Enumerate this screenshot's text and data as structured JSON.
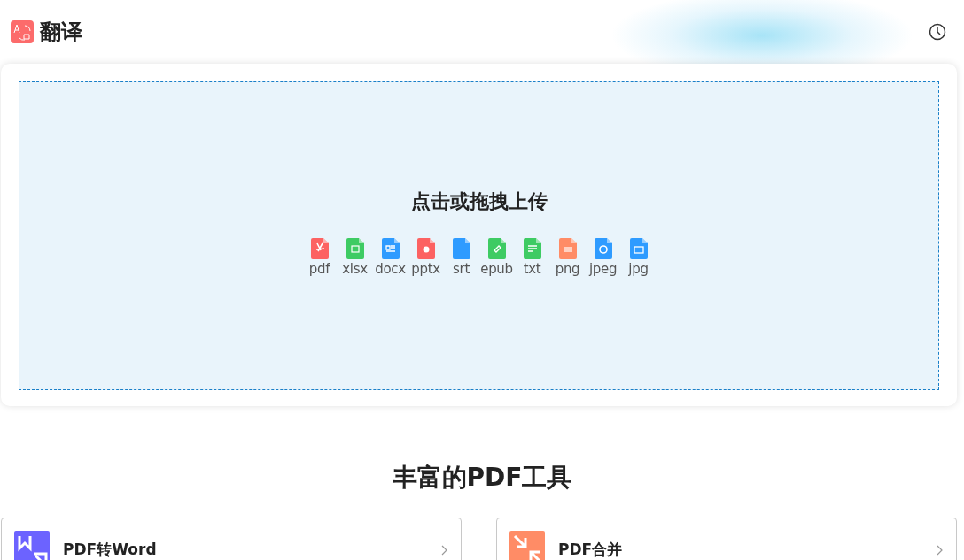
{
  "header": {
    "title": "翻译"
  },
  "upload": {
    "prompt": "点击或拖拽上传",
    "file_types": [
      {
        "label": "pdf",
        "kind": "pdf",
        "color": "#fc6262"
      },
      {
        "label": "xlsx",
        "kind": "sheet",
        "color": "#3ecb63"
      },
      {
        "label": "docx",
        "kind": "doc",
        "color": "#2e9bff"
      },
      {
        "label": "pptx",
        "kind": "slides",
        "color": "#fc6262"
      },
      {
        "label": "srt",
        "kind": "subtitle",
        "color": "#2e9bff"
      },
      {
        "label": "epub",
        "kind": "book",
        "color": "#3ecb63"
      },
      {
        "label": "txt",
        "kind": "text",
        "color": "#3ecb63"
      },
      {
        "label": "png",
        "kind": "pattern",
        "color": "#ff8c66"
      },
      {
        "label": "jpeg",
        "kind": "disc",
        "color": "#2e9bff"
      },
      {
        "label": "jpg",
        "kind": "image",
        "color": "#2e9bff"
      }
    ]
  },
  "tools": {
    "title": "丰富的PDF工具",
    "items": [
      {
        "label": "PDF转Word",
        "kind": "convert",
        "color": "#6c63ff"
      },
      {
        "label": "PDF合并",
        "kind": "merge",
        "color": "#ff8c66"
      }
    ]
  }
}
